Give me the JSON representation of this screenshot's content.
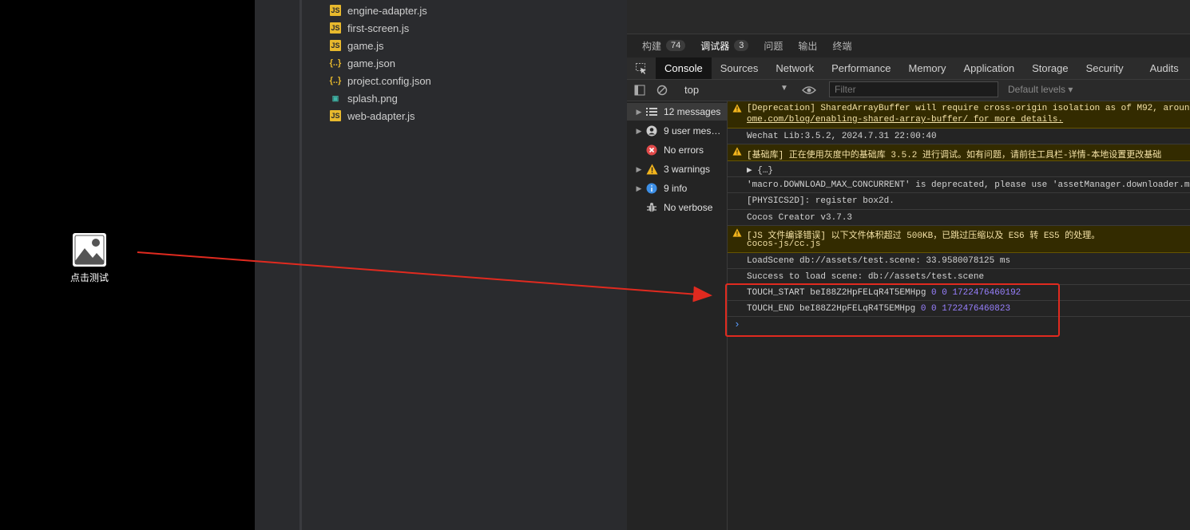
{
  "simulator": {
    "button_label": "点击测试"
  },
  "explorer": {
    "files": [
      {
        "name": "engine-adapter.js",
        "type": "js"
      },
      {
        "name": "first-screen.js",
        "type": "js"
      },
      {
        "name": "game.js",
        "type": "js"
      },
      {
        "name": "game.json",
        "type": "json"
      },
      {
        "name": "project.config.json",
        "type": "json"
      },
      {
        "name": "splash.png",
        "type": "png"
      },
      {
        "name": "web-adapter.js",
        "type": "js"
      }
    ]
  },
  "devtools": {
    "top_tabs": [
      {
        "label": "构建",
        "count": "74"
      },
      {
        "label": "调试器",
        "count": "3",
        "active": true
      },
      {
        "label": "问题"
      },
      {
        "label": "输出"
      },
      {
        "label": "终端"
      }
    ],
    "panel_tabs": [
      "Console",
      "Sources",
      "Network",
      "Performance",
      "Memory",
      "Application",
      "Storage",
      "Security",
      "Audits"
    ],
    "context": "top",
    "filter_placeholder": "Filter",
    "levels_label": "Default levels ▾",
    "sidebar": [
      {
        "label": "12 messages",
        "icon": "list-icon"
      },
      {
        "label": "9 user mess…",
        "icon": "user-icon"
      },
      {
        "label": "No errors",
        "icon": "error-icon"
      },
      {
        "label": "3 warnings",
        "icon": "warning-icon"
      },
      {
        "label": "9 info",
        "icon": "info-icon"
      },
      {
        "label": "No verbose",
        "icon": "bug-icon"
      }
    ],
    "messages": [
      {
        "type": "warn",
        "line1": "[Deprecation] SharedArrayBuffer will require cross-origin isolation as of M92, around",
        "line2": "ome.com/blog/enabling-shared-array-buffer/ for more details."
      },
      {
        "type": "log",
        "text": "Wechat Lib:3.5.2, 2024.7.31 22:00:40"
      },
      {
        "type": "warn",
        "line1": "[基础库] 正在使用灰度中的基础库 3.5.2 进行调试。如有问题，请前往工具栏-详情-本地设置更改基础"
      },
      {
        "type": "log",
        "text": "▶ {…}"
      },
      {
        "type": "log",
        "text": "'macro.DOWNLOAD_MAX_CONCURRENT' is deprecated, please use 'assetManager.downloader.m"
      },
      {
        "type": "log",
        "text": "[PHYSICS2D]: register box2d."
      },
      {
        "type": "log",
        "text": "Cocos Creator v3.7.3"
      },
      {
        "type": "warn",
        "line1": "[JS 文件编译错误] 以下文件体积超过 500KB，已跳过压缩以及 ES6 转 ES5 的处理。",
        "line2": "cocos-js/cc.js"
      },
      {
        "type": "log",
        "text": "LoadScene db://assets/test.scene: 33.9580078125 ms"
      },
      {
        "type": "log",
        "text": "Success to load scene: db://assets/test.scene"
      },
      {
        "type": "touch",
        "label": "TOUCH_START beI88Z2HpFELqR4T5EMHpg",
        "nums": "0 0 1722476460192"
      },
      {
        "type": "touch",
        "label": "TOUCH_END beI88Z2HpFELqR4T5EMHpg",
        "nums": "0 0 1722476460823"
      }
    ]
  },
  "colors": {
    "warning_bg": "#332b00",
    "number": "#9980ff",
    "highlight": "#e02a1f",
    "prompt": "#5a9eff"
  }
}
